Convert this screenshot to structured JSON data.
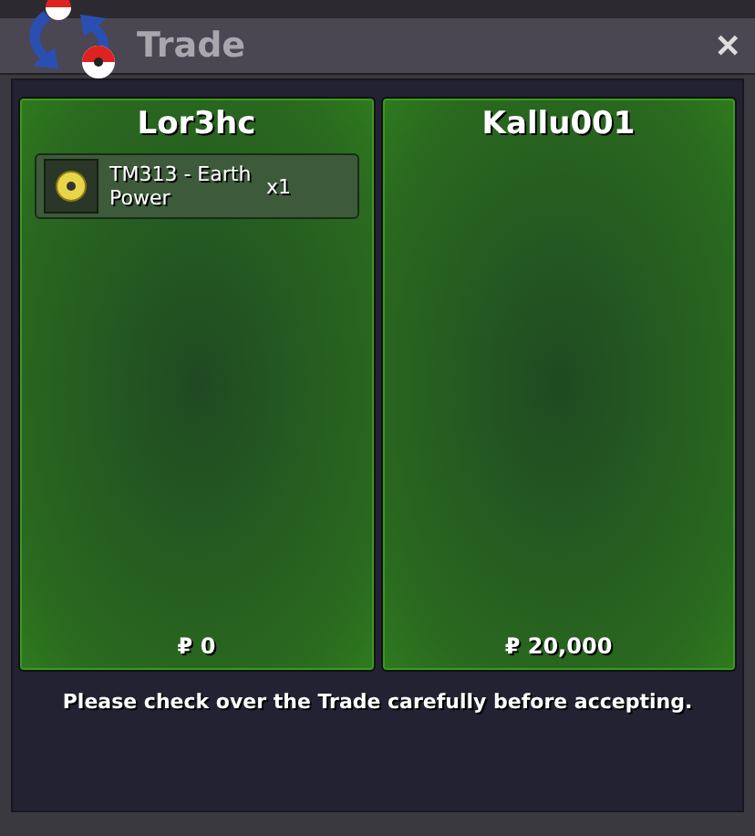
{
  "window": {
    "title": "Trade",
    "close": "✕"
  },
  "traders": [
    {
      "name": "Lor3hc",
      "items": [
        {
          "name": "TM313 - Earth Power",
          "quantity": "x1"
        }
      ],
      "money": "₽ 0"
    },
    {
      "name": "Kallu001",
      "money": "₽ 20,000"
    }
  ],
  "message": "Please check over the Trade carefully before accepting."
}
